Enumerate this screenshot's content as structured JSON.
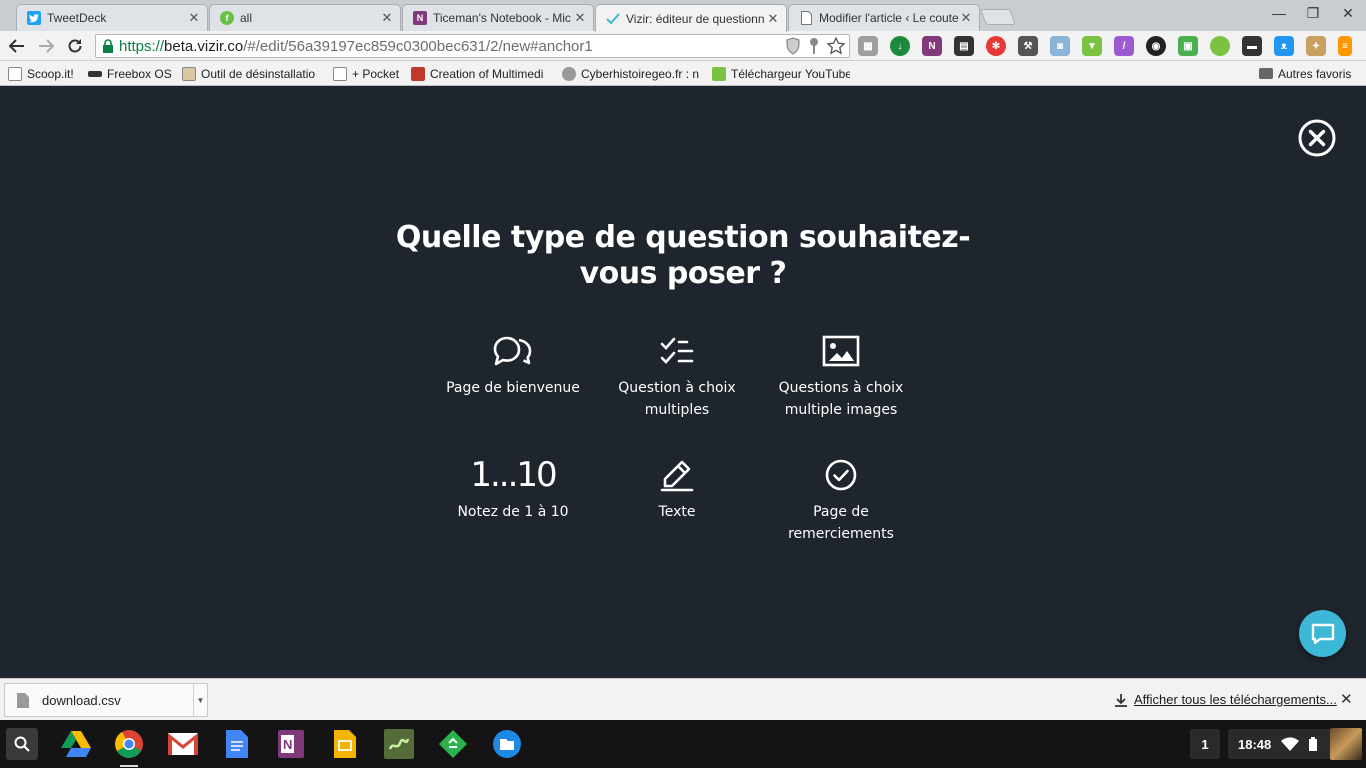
{
  "browser": {
    "tabs": [
      {
        "title": "TweetDeck",
        "favicon_color": "#1da1f2"
      },
      {
        "title": "all",
        "favicon_color": "#6cc04a"
      },
      {
        "title": "Ticeman's Notebook - Mic",
        "favicon_color": "#80397b"
      },
      {
        "title": "Vizir: éditeur de questionn",
        "favicon_color": "#ffffff",
        "active": true
      },
      {
        "title": "Modifier l'article ‹ Le coute",
        "favicon_color": "#ffffff"
      }
    ],
    "window_controls": {
      "minimize": "—",
      "restore": "❐",
      "close": "✕"
    },
    "url": {
      "scheme": "https://",
      "host": "beta.vizir.co",
      "path": "/#/edit/56a39197ec859c0300bec631/2/new#anchor1"
    },
    "extension_icons": [
      "shield-icon",
      "key-icon",
      "star-icon",
      "puzzle-icon",
      "download-green-icon",
      "onenote-icon",
      "film-icon",
      "pinwheel-icon",
      "tools-icon",
      "camera-icon",
      "highlighter-icon",
      "feather-icon",
      "color-wheel-icon",
      "printer-icon",
      "green-dot-icon",
      "chat-icon",
      "cat-icon",
      "rocket-icon",
      "menu-icon"
    ],
    "bookmarks": [
      {
        "label": "Scoop.it!"
      },
      {
        "label": "Freebox OS"
      },
      {
        "label": "Outil de désinstallatio"
      },
      {
        "label": "+ Pocket"
      },
      {
        "label": "Creation of Multimedi"
      },
      {
        "label": "Cyberhistoiregeo.fr : n"
      },
      {
        "label": "Téléchargeur YouTube"
      }
    ],
    "other_bookmarks": "Autres favoris"
  },
  "page": {
    "heading_line1": "Quelle type de question souhaitez-",
    "heading_line2": "vous poser ?",
    "question_types": [
      {
        "label_line1": "Page de bienvenue",
        "label_line2": "",
        "icon": "speech-bubbles-icon"
      },
      {
        "label_line1": "Question à choix",
        "label_line2": "multiples",
        "icon": "checklist-icon"
      },
      {
        "label_line1": "Questions à choix",
        "label_line2": "multiple images",
        "icon": "image-icon"
      },
      {
        "label_line1": "Notez de 1 à 10",
        "label_line2": "",
        "icon": "rating-scale-icon",
        "icon_text": "1...10"
      },
      {
        "label_line1": "Texte",
        "label_line2": "",
        "icon": "pencil-icon"
      },
      {
        "label_line1": "Page de",
        "label_line2": "remerciements",
        "icon": "check-circle-icon"
      }
    ]
  },
  "downloads": {
    "file_name": "download.csv",
    "show_all": "Afficher tous les téléchargements..."
  },
  "shelf": {
    "apps": [
      "drive-icon",
      "chrome-icon",
      "gmail-icon",
      "docs-icon",
      "onenote-icon",
      "slides-icon",
      "scratch-icon",
      "feedly-icon",
      "files-icon"
    ],
    "notification_count": "1",
    "time": "18:48"
  },
  "colors": {
    "page_bg": "#1f252d",
    "chat_button": "#3db7d6",
    "url_secure": "#0b8043"
  }
}
